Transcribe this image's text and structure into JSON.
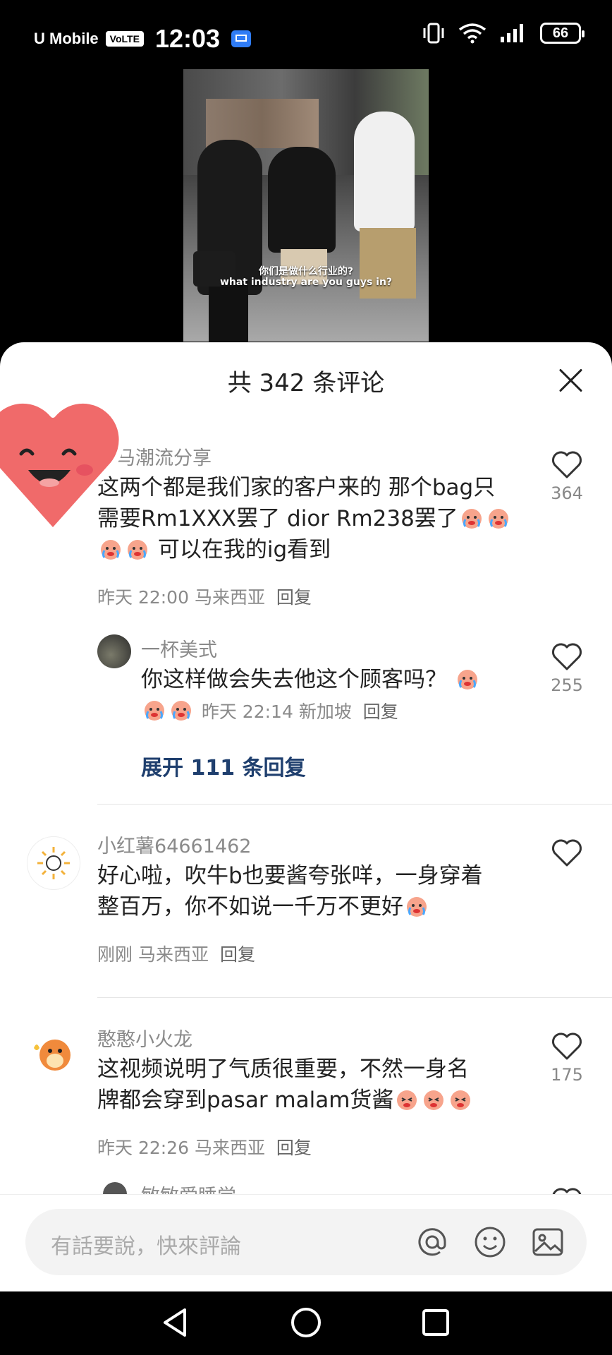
{
  "status_bar": {
    "carrier": "U Mobile",
    "volte": "VoLTE",
    "time": "12:03",
    "battery": "66"
  },
  "video": {
    "caption_cn": "你们是做什么行业的?",
    "caption_en": "what industry are you guys in?"
  },
  "sheet": {
    "title": "共 342 条评论"
  },
  "comments": [
    {
      "name": "大马潮流分享",
      "text_line1": "这两个都是我们家的客户来的 那个bag只",
      "text_line2": "需要Rm1XXX罢了 dior Rm238罢了",
      "text_line3": "可以在我的ig看到",
      "time": "昨天 22:00",
      "location": "马来西亚",
      "reply": "回复",
      "likes": "364"
    },
    {
      "name": "一杯美式",
      "text_line1": "你这样做会失去他这个顾客吗？",
      "time": "昨天 22:14",
      "location": "新加坡",
      "reply": "回复",
      "likes": "255",
      "expand": "展开 111 条回复"
    },
    {
      "name": "小红薯64661462",
      "text_line1": "好心啦，吹牛b也要酱夸张咩，一身穿着",
      "text_line2": "整百万，你不如说一千万不更好",
      "time": "刚刚",
      "location": "马来西亚",
      "reply": "回复",
      "likes": ""
    },
    {
      "name": "憨憨小火龙",
      "text_line1": "这视频说明了气质很重要，不然一身名",
      "text_line2": "牌都会穿到pasar malam货酱",
      "time": "昨天 22:26",
      "location": "马来西亚",
      "reply": "回复",
      "likes": "175"
    },
    {
      "name": "敏敏爱睡觉"
    }
  ],
  "input": {
    "placeholder": "有話要說，快來評論"
  },
  "icons": {
    "like": "heart-outline-icon",
    "mention": "at-icon",
    "emoji": "smiley-icon",
    "image": "image-icon",
    "close": "close-icon"
  },
  "colors": {
    "expand_link": "#1f3f6e",
    "muted": "#8a8a8a",
    "sticker_heart": "#f06a6a"
  }
}
